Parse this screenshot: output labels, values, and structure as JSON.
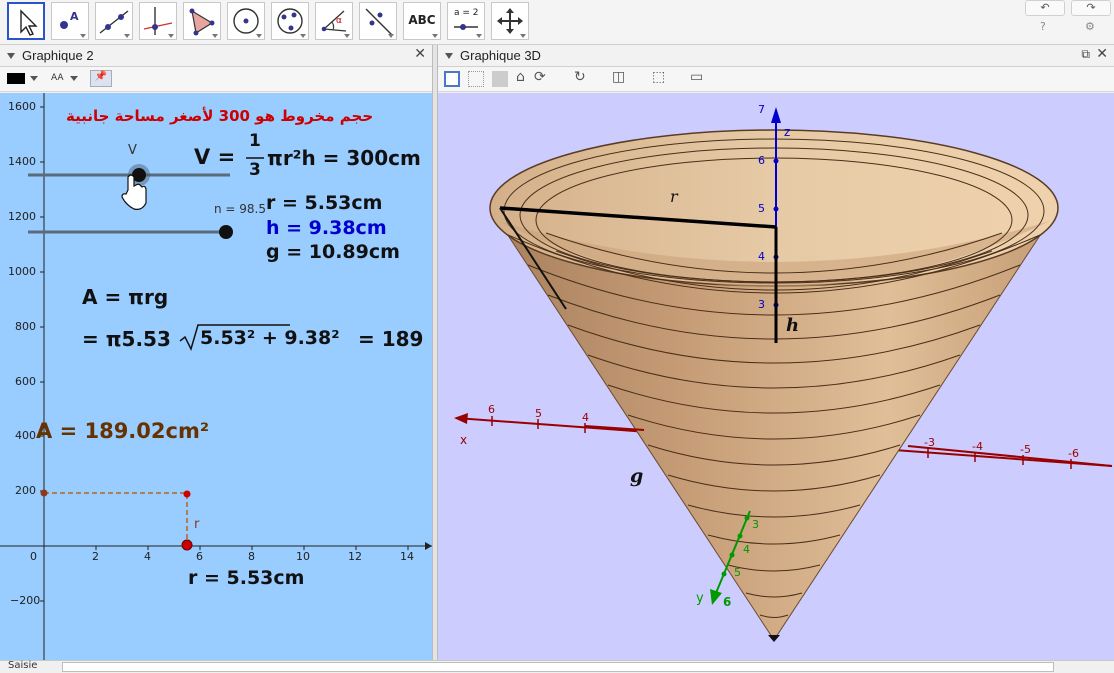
{
  "toolbar": {
    "tools": [
      "move-tool",
      "point-tool",
      "line-tool",
      "perpendicular-line-tool",
      "polygon-tool",
      "circle-tool",
      "conic-tool",
      "angle-tool",
      "reflect-tool",
      "text-tool",
      "slider-tool",
      "move-view-tool"
    ],
    "text_tool_label": "ABC",
    "slider_tool_label": "a = 2"
  },
  "graphics2": {
    "title": "Graphique 2",
    "arabic_title": "حجم مخروط هو 300 لأصغر مساحة جانبية",
    "slider_v_label": "V",
    "slider_n_label": "n = 98.5",
    "formula_v_lhs": "V =",
    "formula_v_frac_num": "1",
    "formula_v_frac_den": "3",
    "formula_v_rhs": "πr²h = 300cm",
    "r_text": "r = 5.53cm",
    "h_text": "h = 9.38cm",
    "g_text": "g = 10.89cm",
    "area_formula": "A = πrg",
    "area_expand_pre": "= π5.53",
    "area_expand_rad": "5.53² + 9.38²",
    "area_expand_post": "= 189",
    "area_value": "A = 189.02cm²",
    "point_r_label": "r",
    "bottom_r_text": "r = 5.53cm",
    "y_ticks": [
      "1600",
      "1400",
      "1200",
      "1000",
      "800",
      "600",
      "400",
      "200",
      "0",
      "−200"
    ],
    "x_ticks": [
      "2",
      "4",
      "6",
      "8",
      "10",
      "12",
      "14"
    ],
    "colors": {
      "bg": "#99ccff",
      "arabic": "#cc0000",
      "h_text": "#0000cc",
      "area_value": "#663300",
      "dashed": "#b5651d",
      "point": "#cc0000"
    }
  },
  "graphics3d": {
    "title": "Graphique 3D",
    "label_r": "r",
    "label_h": "h",
    "label_g": "g",
    "axis_x_name": "x",
    "axis_y_name": "y",
    "axis_z_name": "z",
    "x_ticks": [
      "6",
      "5",
      "4"
    ],
    "x_neg_ticks": [
      "-3",
      "-4",
      "-5",
      "-6"
    ],
    "z_ticks": [
      "7",
      "6",
      "5",
      "4",
      "3"
    ],
    "y_ticks": [
      "3",
      "4",
      "5",
      "6"
    ],
    "colors": {
      "bg": "#ccccff",
      "cone": "#c8a078",
      "x_axis": "#990000",
      "y_axis": "#009900",
      "z_axis": "#0000cc"
    }
  },
  "inputbar": {
    "label": "Saisie"
  }
}
